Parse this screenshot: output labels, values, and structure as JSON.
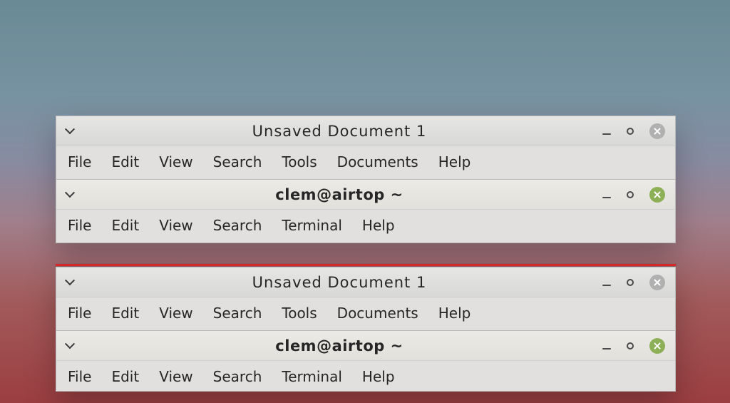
{
  "windows_top": [
    {
      "title": "Unsaved Document 1",
      "title_bold": false,
      "active": false,
      "menu": [
        "File",
        "Edit",
        "View",
        "Search",
        "Tools",
        "Documents",
        "Help"
      ]
    },
    {
      "title": "clem@airtop ~",
      "title_bold": true,
      "active": true,
      "menu": [
        "File",
        "Edit",
        "View",
        "Search",
        "Terminal",
        "Help"
      ]
    }
  ],
  "windows_bottom": [
    {
      "title": "Unsaved Document 1",
      "title_bold": false,
      "active": false,
      "menu": [
        "File",
        "Edit",
        "View",
        "Search",
        "Tools",
        "Documents",
        "Help"
      ]
    },
    {
      "title": "clem@airtop ~",
      "title_bold": true,
      "active": true,
      "menu": [
        "File",
        "Edit",
        "View",
        "Search",
        "Terminal",
        "Help"
      ]
    }
  ],
  "icons": {
    "chevron": "chevron-down-icon",
    "minimize": "minimize-icon",
    "maximize": "maximize-icon",
    "close": "close-icon"
  }
}
